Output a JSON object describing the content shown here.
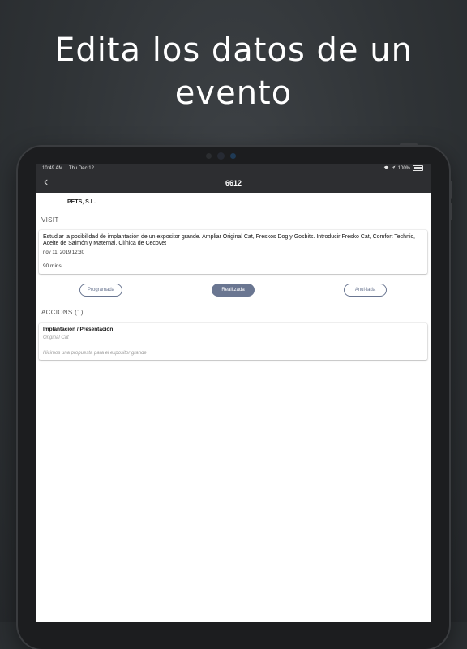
{
  "promo": {
    "headline_line1": "Edita los datos de un",
    "headline_line2": "evento"
  },
  "status_bar": {
    "time": "10:49 AM",
    "date": "Thu Dec 12",
    "battery": "100%"
  },
  "navbar": {
    "title": "6612",
    "back_icon": "chevron-left-icon"
  },
  "company": "PETS, S.L.",
  "visit": {
    "section_label": "VISIT",
    "description": "Estudiar la posibilidad de implantación de un expositor grande. Ampliar Original Cat, Freskos Dog y Gosbits. Introducir Fresko Cat, Comfort Technic, Aceite de Salmón y Maternal. Clínica de Cecovet",
    "date": "nov 11, 2019 12:30",
    "duration": "90 mins"
  },
  "status_options": [
    {
      "label": "Programada",
      "selected": false
    },
    {
      "label": "Realitzada",
      "selected": true
    },
    {
      "label": "Anul·lada",
      "selected": false
    }
  ],
  "accions": {
    "section_label": "ACCIONS (1)",
    "items": [
      {
        "title": "Implantación / Presentación",
        "product": "Original Cat",
        "note": "Hicimos una propuesta para el expositor grande"
      }
    ]
  },
  "colors": {
    "accent": "#6a7691",
    "navbar_bg": "#2d2e31",
    "background": "#2f3336"
  }
}
